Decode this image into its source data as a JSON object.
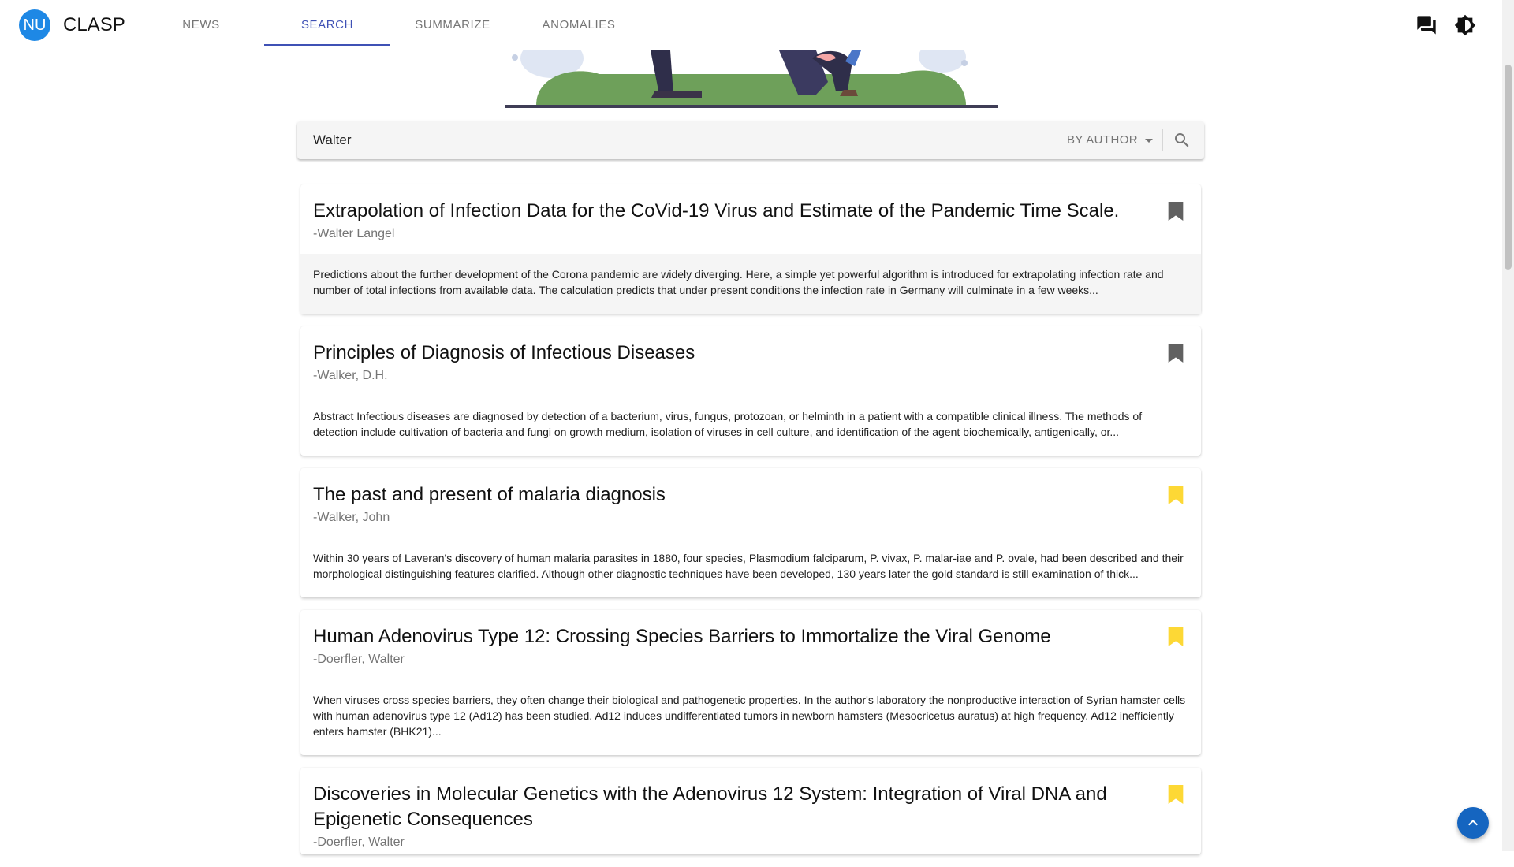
{
  "app": {
    "logo_initials": "NU",
    "title": "CLASP"
  },
  "nav": {
    "tabs": [
      {
        "label": "NEWS",
        "active": false
      },
      {
        "label": "SEARCH",
        "active": true
      },
      {
        "label": "SUMMARIZE",
        "active": false
      },
      {
        "label": "ANOMALIES",
        "active": false
      }
    ]
  },
  "toolbar_icons": [
    "chat-icon",
    "brightness-icon"
  ],
  "search": {
    "query": "Walter",
    "mode": "BY AUTHOR",
    "search_icon": "search-icon"
  },
  "results": [
    {
      "title": "Extrapolation of Infection Data for the CoVid-19 Virus and Estimate of the Pandemic Time Scale.",
      "author": "-Walter Langel",
      "abstract": "Predictions about the further development of the Corona pandemic are widely diverging. Here, a simple yet powerful algorithm is introduced for extrapolating infection rate and number of total infections from available data. The calculation predicts that under present conditions the infection rate in Germany will culminate in a few weeks...",
      "bookmarked": false
    },
    {
      "title": "Principles of Diagnosis of Infectious Diseases",
      "author": "-Walker, D.H.",
      "abstract": "Abstract Infectious diseases are diagnosed by detection of a bacterium, virus, fungus, protozoan, or helminth in a patient with a compatible clinical illness. The methods of detection include cultivation of bacteria and fungi on growth medium, isolation of viruses in cell culture, and identification of the agent biochemically, antigenically, or...",
      "bookmarked": false
    },
    {
      "title": "The past and present of malaria diagnosis",
      "author": "-Walker, John",
      "abstract": "Within 30 years of Laveran's discovery of human malaria parasites in 1880, four species, Plasmodium falciparum, P. vivax, P. malar-iae and P. ovale, had been described and their morphological distinguishing features clarified. Although other diagnostic techniques have been developed, 130 years later the gold standard is still examination of thick...",
      "bookmarked": true
    },
    {
      "title": "Human Adenovirus Type 12: Crossing Species Barriers to Immortalize the Viral Genome",
      "author": "-Doerfler, Walter",
      "abstract": "When viruses cross species barriers, they often change their biological and pathogenetic properties. In the author's laboratory the nonproductive interaction of Syrian hamster cells with human adenovirus type 12 (Ad12) has been studied. Ad12 induces undifferentiated tumors in newborn hamsters (Mesocricetus auratus) at high frequency. Ad12 inefficiently enters hamster (BHK21)...",
      "bookmarked": true
    },
    {
      "title": "Discoveries in Molecular Genetics with the Adenovirus 12 System: Integration of Viral DNA and Epigenetic Consequences",
      "author": "-Doerfler, Walter",
      "abstract": "",
      "bookmarked": true
    }
  ],
  "colors": {
    "accent": "#3f51b5",
    "logo": "#1e88e5",
    "bookmark_active": "#fdd835",
    "bookmark_inactive": "#616161",
    "fab": "#1565c0",
    "hero_bush": "#6ea05a"
  },
  "fab": {
    "icon": "chevron-up-icon"
  }
}
